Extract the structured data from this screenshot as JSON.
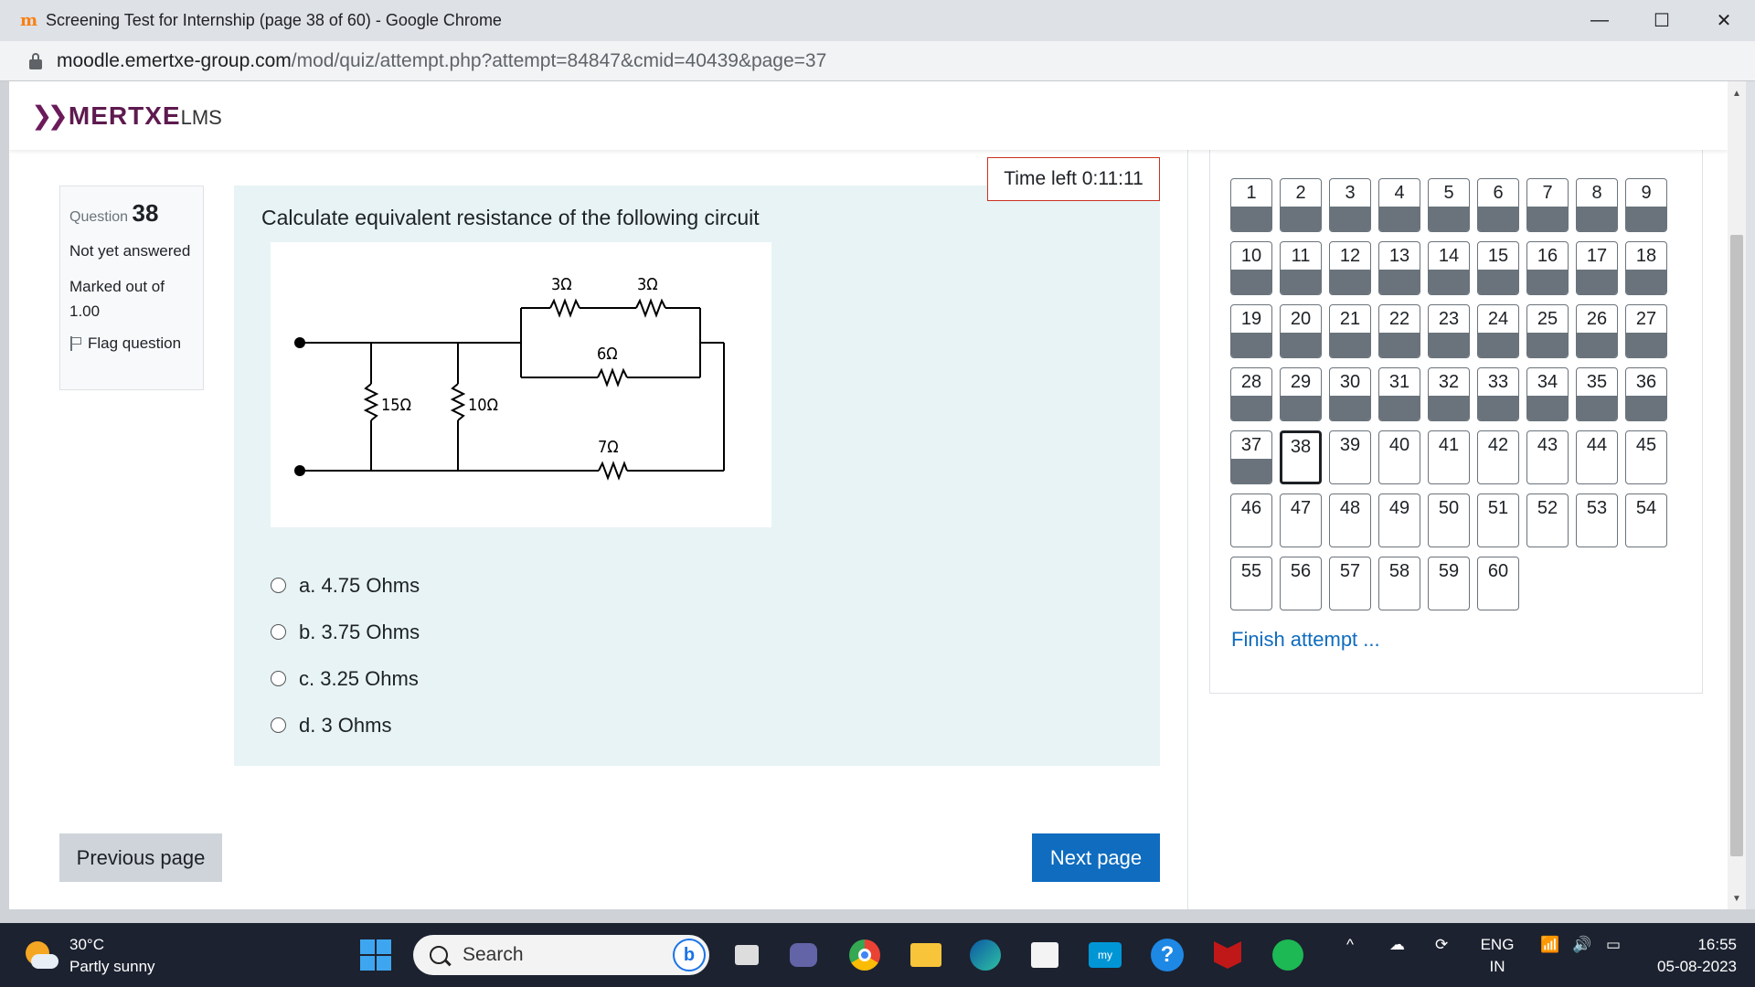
{
  "browser": {
    "tab_title": "Screening Test for Internship (page 38 of 60) - Google Chrome",
    "url_host": "moodle.emertxe-group.com",
    "url_path": "/mod/quiz/attempt.php?attempt=84847&cmid=40439&page=37",
    "minimize": "—",
    "maximize": "☐",
    "close": "✕"
  },
  "site": {
    "logo_brand": "MERTXE",
    "logo_suffix": "LMS"
  },
  "question_info": {
    "label": "Question",
    "number": "38",
    "state": "Not yet answered",
    "mark": "Marked out of 1.00",
    "flag": "Flag question"
  },
  "timer": "Time left 0:11:11",
  "question": {
    "text": "Calculate equivalent resistance of the following circuit",
    "circuit_labels": [
      "3Ω",
      "3Ω",
      "6Ω",
      "15Ω",
      "10Ω",
      "7Ω"
    ],
    "answers": [
      "a. 4.75 Ohms",
      "b. 3.75 Ohms",
      "c. 3.25 Ohms",
      "d. 3 Ohms"
    ]
  },
  "buttons": {
    "prev": "Previous page",
    "next": "Next page"
  },
  "quiz_nav": {
    "answered_until": 37,
    "current": 38,
    "items": [
      "1",
      "2",
      "3",
      "4",
      "5",
      "6",
      "7",
      "8",
      "9",
      "10",
      "11",
      "12",
      "13",
      "14",
      "15",
      "16",
      "17",
      "18",
      "19",
      "20",
      "21",
      "22",
      "23",
      "24",
      "25",
      "26",
      "27",
      "28",
      "29",
      "30",
      "31",
      "32",
      "33",
      "34",
      "35",
      "36",
      "37",
      "38",
      "39",
      "40",
      "41",
      "42",
      "43",
      "44",
      "45",
      "46",
      "47",
      "48",
      "49",
      "50",
      "51",
      "52",
      "53",
      "54",
      "55",
      "56",
      "57",
      "58",
      "59",
      "60"
    ],
    "finish": "Finish attempt ..."
  },
  "taskbar": {
    "temp": "30°C",
    "weather": "Partly sunny",
    "search": "Search",
    "lang_top": "ENG",
    "lang_bottom": "IN",
    "time": "16:55",
    "date": "05-08-2023"
  },
  "colors": {
    "accent": "#0f6cbf",
    "timer_border": "#ca3120",
    "answered_fill": "#6a737b",
    "brand": "#5e1a4f"
  }
}
